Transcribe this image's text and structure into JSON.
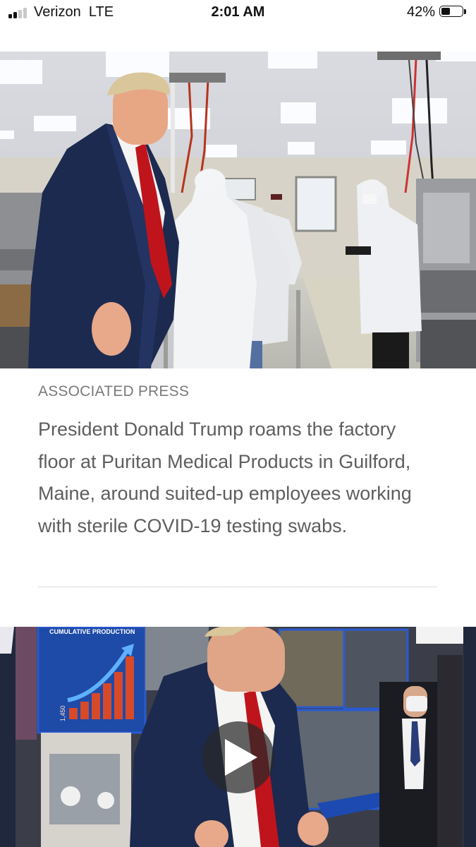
{
  "status_bar": {
    "carrier": "Verizon",
    "network": "LTE",
    "time": "2:01 AM",
    "battery": "42%",
    "battery_level": 0.42,
    "signal_bars": 2
  },
  "article": {
    "photo_credit": "ASSOCIATED PRESS",
    "caption": "President Donald Trump roams the factory floor at Puritan Medical Products in Guilford, Maine, around suited-up employees working with sterile COVID-19 testing swabs.",
    "video": {
      "poster_chart_title": "CUMULATIVE PRODUCTION",
      "poster_chart_value": "1,450"
    }
  },
  "colors": {
    "caption_text": "#5e5e5e",
    "credit_text": "#7a7a7a",
    "suit_navy": "#1c2a4f",
    "tie_red": "#c0141c",
    "panel_blue": "#1e4aa8"
  }
}
